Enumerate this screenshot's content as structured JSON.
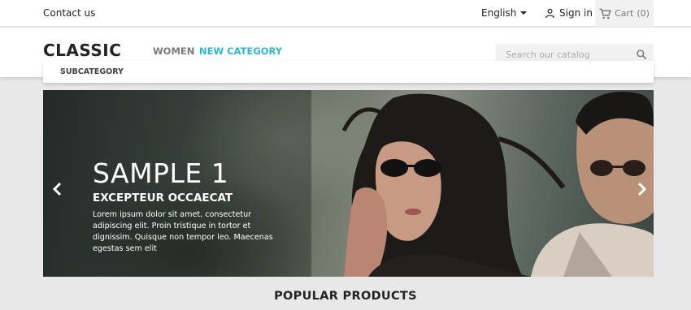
{
  "topbar": {
    "contact": "Contact us",
    "language": "English",
    "signin": "Sign in",
    "cart": "Cart",
    "cart_count": "(0)"
  },
  "header": {
    "logo": "CLASSIC",
    "menu": [
      {
        "label": "WOMEN"
      },
      {
        "label": "NEW CATEGORY"
      }
    ],
    "search_placeholder": "Search our catalog"
  },
  "submenu": {
    "items": [
      {
        "label": "SUBCATEGORY"
      }
    ]
  },
  "carousel": {
    "title": "SAMPLE 1",
    "subtitle": "EXCEPTEUR OCCAECAT",
    "text": "Lorem ipsum dolor sit amet, consectetur adipiscing elit. Proin tristique in tortor et dignissim. Quisque non tempor leo. Maecenas egestas sem elit",
    "prev_icon": "chevron-left-icon",
    "next_icon": "chevron-right-icon"
  },
  "main": {
    "section_title": "POPULAR PRODUCTS"
  },
  "colors": {
    "accent": "#2fb5d2",
    "text": "#232323",
    "muted": "#7a7a7a",
    "background": "#e8e8e8"
  }
}
